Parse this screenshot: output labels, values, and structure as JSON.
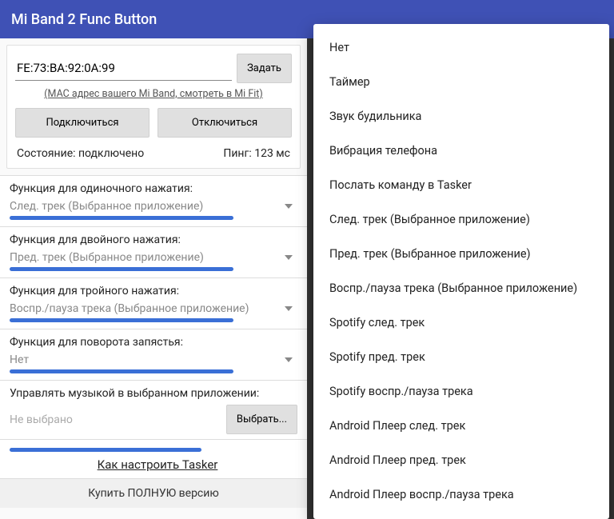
{
  "left": {
    "title": "Mi Band 2 Func Button",
    "mac": "FE:73:BA:92:0A:99",
    "set_btn": "Задать",
    "mac_hint": "(MAC адрес вашего Mi Band, смотреть в Mi Fit)",
    "connect": "Подключиться",
    "disconnect": "Отключиться",
    "status_label": "Состояние: подключено",
    "ping_label": "Пинг: 123 мс",
    "functions": [
      {
        "label": "Функция для одиночного нажатия:",
        "value": "След. трек (Выбранное приложение)"
      },
      {
        "label": "Функция для двойного нажатия:",
        "value": "Пред. трек (Выбранное приложение)"
      },
      {
        "label": "Функция для тройного нажатия:",
        "value": "Воспр./пауза трека (Выбранное приложение)"
      },
      {
        "label": "Функция для поворота запястья:",
        "value": "Нет"
      }
    ],
    "music_label": "Управлять музыкой в выбранном приложении:",
    "music_value": "Не выбрано",
    "choose_btn": "Выбрать...",
    "tasker_link": "Как настроить Tasker",
    "buy_full": "Купить ПОЛНУЮ версию"
  },
  "right": {
    "options": [
      "Нет",
      "Таймер",
      "Звук будильника",
      "Вибрация телефона",
      "Послать команду в Tasker",
      "След. трек (Выбранное приложение)",
      "Пред. трек (Выбранное приложение)",
      "Воспр./пауза трека (Выбранное приложение)",
      "Spotify след. трек",
      "Spotify пред. трек",
      "Spotify воспр./пауза трека",
      "Android Плеер след. трек",
      "Android Плеер пред. трек",
      "Android Плеер воспр./пауза трека"
    ]
  }
}
